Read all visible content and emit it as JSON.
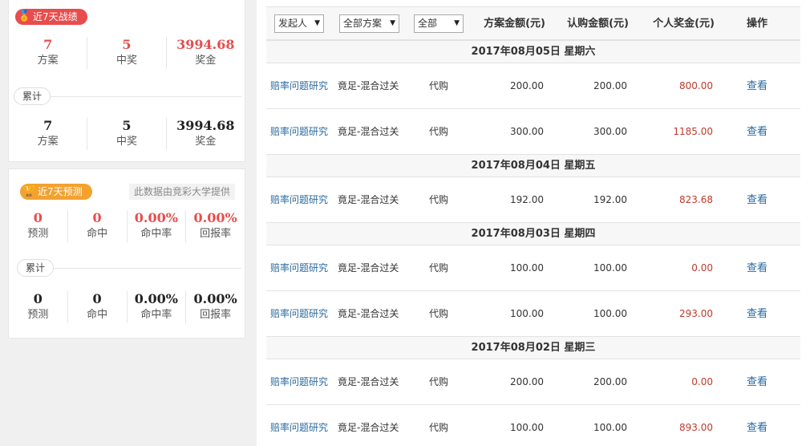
{
  "left": {
    "recent": {
      "badge": "近7天战绩",
      "stats": [
        {
          "value": "7",
          "label": "方案"
        },
        {
          "value": "5",
          "label": "中奖"
        },
        {
          "value": "3994.68",
          "label": "奖金"
        }
      ],
      "cumulative_label": "累计",
      "cumulative": [
        {
          "value": "7",
          "label": "方案"
        },
        {
          "value": "5",
          "label": "中奖"
        },
        {
          "value": "3994.68",
          "label": "奖金"
        }
      ]
    },
    "forecast": {
      "badge": "近7天预测",
      "source": "此数据由竞彩大学提供",
      "stats": [
        {
          "value": "0",
          "label": "预测"
        },
        {
          "value": "0",
          "label": "命中"
        },
        {
          "value": "0.00%",
          "label": "命中率"
        },
        {
          "value": "0.00%",
          "label": "回报率"
        }
      ],
      "cumulative_label": "累计",
      "cumulative": [
        {
          "value": "0",
          "label": "预测"
        },
        {
          "value": "0",
          "label": "命中"
        },
        {
          "value": "0.00%",
          "label": "命中率"
        },
        {
          "value": "0.00%",
          "label": "回报率"
        }
      ]
    }
  },
  "table": {
    "filters": {
      "initiator": "发起人",
      "scheme": "全部方案",
      "all": "全部"
    },
    "headers": {
      "amount": "方案金额(元)",
      "subscribe": "认购金额(元)",
      "prize": "个人奖金(元)",
      "action": "操作"
    },
    "groups": [
      {
        "date": "2017年08月05日 星期六",
        "rows": [
          {
            "name": "赔率问题研究",
            "type": "竟足-混合过关",
            "mode": "代购",
            "amount": "200.00",
            "subscribe": "200.00",
            "prize": "800.00",
            "action": "查看"
          },
          {
            "name": "赔率问题研究",
            "type": "竟足-混合过关",
            "mode": "代购",
            "amount": "300.00",
            "subscribe": "300.00",
            "prize": "1185.00",
            "action": "查看"
          }
        ]
      },
      {
        "date": "2017年08月04日 星期五",
        "rows": [
          {
            "name": "赔率问题研究",
            "type": "竟足-混合过关",
            "mode": "代购",
            "amount": "192.00",
            "subscribe": "192.00",
            "prize": "823.68",
            "action": "查看"
          }
        ]
      },
      {
        "date": "2017年08月03日 星期四",
        "rows": [
          {
            "name": "赔率问题研究",
            "type": "竟足-混合过关",
            "mode": "代购",
            "amount": "100.00",
            "subscribe": "100.00",
            "prize": "0.00",
            "action": "查看"
          },
          {
            "name": "赔率问题研究",
            "type": "竟足-混合过关",
            "mode": "代购",
            "amount": "100.00",
            "subscribe": "100.00",
            "prize": "293.00",
            "action": "查看"
          }
        ]
      },
      {
        "date": "2017年08月02日 星期三",
        "rows": [
          {
            "name": "赔率问题研究",
            "type": "竟足-混合过关",
            "mode": "代购",
            "amount": "200.00",
            "subscribe": "200.00",
            "prize": "0.00",
            "action": "查看"
          },
          {
            "name": "赔率问题研究",
            "type": "竟足-混合过关",
            "mode": "代购",
            "amount": "100.00",
            "subscribe": "100.00",
            "prize": "893.00",
            "action": "查看"
          }
        ]
      }
    ]
  },
  "colors": {
    "accent_red": "#e84c4c",
    "accent_orange": "#f3a22e",
    "link_blue": "#2a6a9f",
    "prize_red": "#c0392b"
  },
  "icons": {
    "medal": "medal-icon",
    "trophy": "trophy-icon"
  }
}
